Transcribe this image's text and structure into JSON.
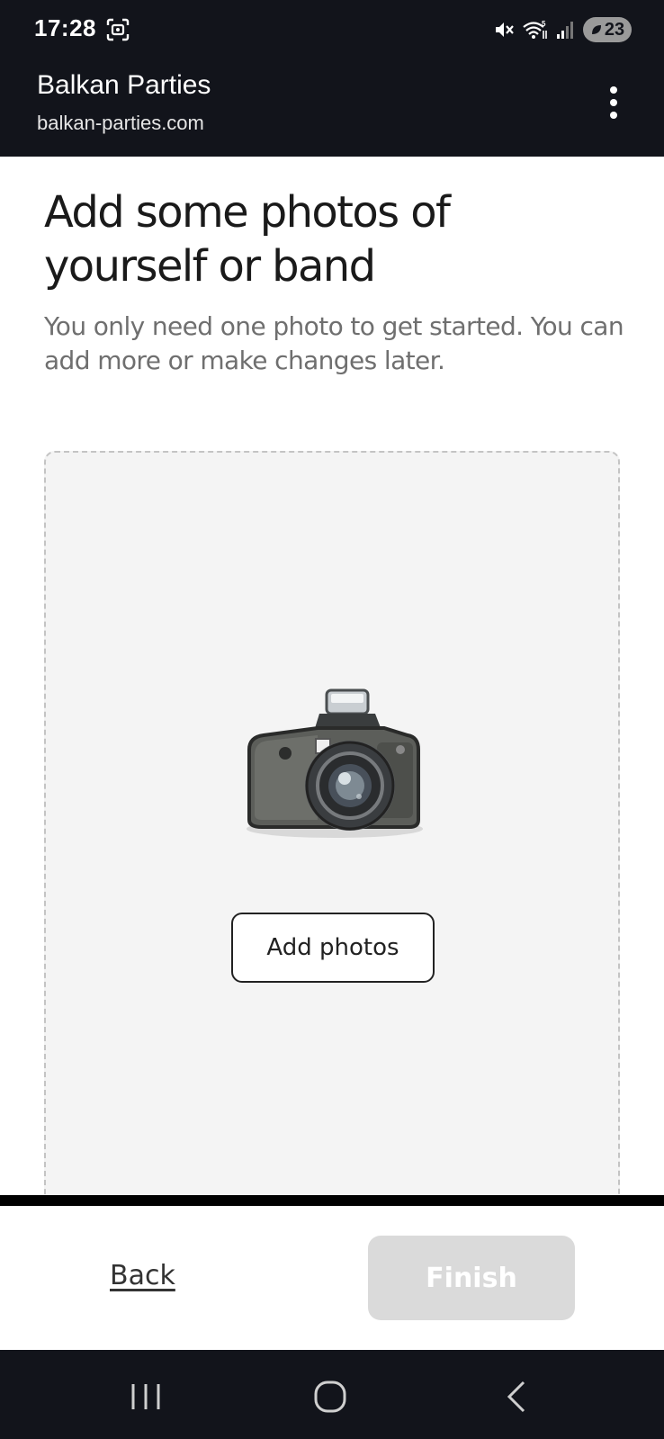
{
  "status_bar": {
    "time": "17:28",
    "battery": "23",
    "icons": [
      "screenshot-icon",
      "mute-icon",
      "wifi-icon",
      "signal-icon",
      "battery-icon"
    ]
  },
  "browser": {
    "site_title": "Balkan Parties",
    "site_url": "balkan-parties.com",
    "menu_icon": "more-vert-icon"
  },
  "page": {
    "heading": "Add some photos of yourself or band",
    "subheading": "You only need one photo to get started. You can add more or make changes later."
  },
  "upload": {
    "image_icon": "camera-icon",
    "add_photos_label": "Add photos"
  },
  "actions": {
    "back_label": "Back",
    "finish_label": "Finish",
    "finish_enabled": false
  },
  "nav_bar": {
    "icons": [
      "recent-apps-icon",
      "home-icon",
      "back-icon"
    ]
  },
  "colors": {
    "topbar_bg": "#12141b",
    "dropzone_bg": "#f4f4f4",
    "finish_disabled_bg": "#dadada",
    "heading_text": "#1a1a1a",
    "subheading_text": "#6f6f6f"
  }
}
